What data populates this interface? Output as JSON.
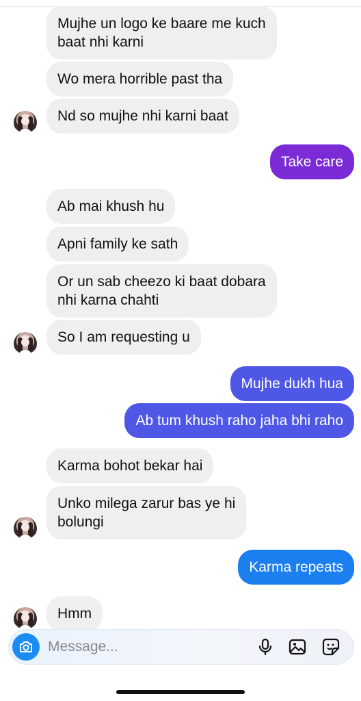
{
  "incoming_group_1": [
    {
      "text": "Mujhe un logo ke baare me kuch\nbaat nhi karni"
    },
    {
      "text": "Wo mera horrible past tha"
    },
    {
      "text": "Nd so mujhe nhi karni baat"
    }
  ],
  "outgoing_1": {
    "text": "Take care",
    "color": "#7a2bd6"
  },
  "incoming_group_2": [
    {
      "text": "Ab mai khush hu"
    },
    {
      "text": "Apni family ke sath"
    },
    {
      "text": "Or un sab cheezo ki baat dobara\nnhi karna chahti"
    },
    {
      "text": "So I am requesting u"
    }
  ],
  "outgoing_2": [
    {
      "text": "Mujhe dukh hua",
      "color": "#4f57e6"
    },
    {
      "text": "Ab tum khush raho jaha bhi raho",
      "color": "#4f57e6"
    }
  ],
  "incoming_group_3": [
    {
      "text": "Karma bohot bekar hai"
    },
    {
      "text": "Unko milega zarur bas ye hi\nbolungi"
    }
  ],
  "outgoing_3": {
    "text": "Karma repeats",
    "color": "#1c7ff0"
  },
  "incoming_group_4": [
    {
      "text": "Hmm"
    }
  ],
  "composer": {
    "placeholder": "Message...",
    "icons": [
      "camera-icon",
      "microphone-icon",
      "gallery-icon",
      "sticker-icon"
    ]
  }
}
